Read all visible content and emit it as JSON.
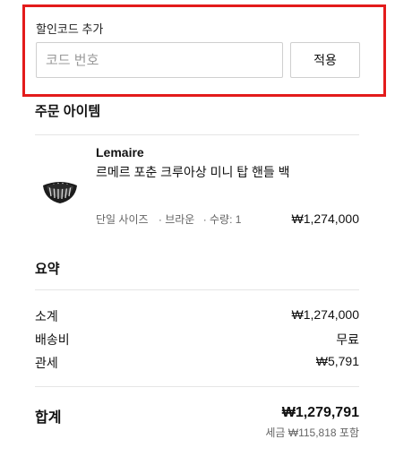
{
  "promo": {
    "label": "할인코드 추가",
    "placeholder": "코드 번호",
    "value": "",
    "apply_label": "적용",
    "highlight_color": "#e31b1b"
  },
  "order_items": {
    "title": "주문 아이템",
    "items": [
      {
        "brand": "Lemaire",
        "name": "르메르 포춘 크루아상 미니 탑 핸들 백",
        "size": "단일 사이즈",
        "color": "· 브라운",
        "quantity": "· 수량: 1",
        "price": "₩1,274,000",
        "image_icon": "croissant-bag-image"
      }
    ]
  },
  "summary": {
    "title": "요약",
    "rows": [
      {
        "label": "소계",
        "value": "₩1,274,000"
      },
      {
        "label": "배송비",
        "value": "무료"
      },
      {
        "label": "관세",
        "value": "₩5,791"
      }
    ],
    "total_label": "합계",
    "total_value": "₩1,279,791",
    "tax_note": "세금 ₩115,818 포함"
  }
}
